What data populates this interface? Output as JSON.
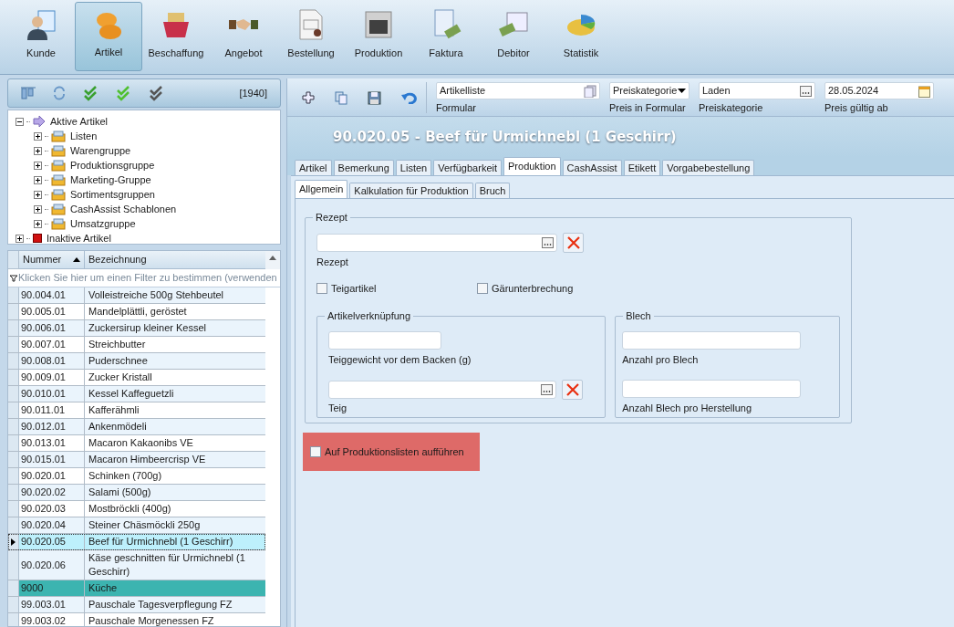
{
  "ribbon": [
    {
      "label": "Kunde",
      "selected": false
    },
    {
      "label": "Artikel",
      "selected": true
    },
    {
      "label": "Beschaffung",
      "selected": false
    },
    {
      "label": "Angebot",
      "selected": false
    },
    {
      "label": "Bestellung",
      "selected": false
    },
    {
      "label": "Produktion",
      "selected": false
    },
    {
      "label": "Faktura",
      "selected": false
    },
    {
      "label": "Debitor",
      "selected": false
    },
    {
      "label": "Statistik",
      "selected": false
    }
  ],
  "left_toolbar": {
    "count": "[1940]"
  },
  "tree": [
    {
      "label": "Aktive Artikel",
      "kind": "arrow",
      "expanded": true,
      "children": [
        {
          "label": "Listen",
          "kind": "folder",
          "expanded": false
        },
        {
          "label": "Warengruppe",
          "kind": "folder",
          "expanded": false
        },
        {
          "label": "Produktionsgruppe",
          "kind": "folder",
          "expanded": false
        },
        {
          "label": "Marketing-Gruppe",
          "kind": "folder",
          "expanded": false
        },
        {
          "label": "Sortimentsgruppen",
          "kind": "folder",
          "expanded": false
        },
        {
          "label": "CashAssist Schablonen",
          "kind": "folder",
          "expanded": false
        },
        {
          "label": "Umsatzgruppe",
          "kind": "folder",
          "expanded": false
        }
      ]
    },
    {
      "label": "Inaktive Artikel",
      "kind": "stop",
      "expanded": false
    }
  ],
  "grid": {
    "columns": [
      "Nummer",
      "Bezeichnung"
    ],
    "filter_hint": "Klicken Sie hier um einen Filter zu bestimmen (verwenden",
    "rows": [
      {
        "nummer": "90.004.01",
        "bezeichnung": "Volleistreiche 500g Stehbeutel",
        "selected": false,
        "highlighted": false
      },
      {
        "nummer": "90.005.01",
        "bezeichnung": "Mandelplättli, geröstet",
        "selected": false,
        "highlighted": false
      },
      {
        "nummer": "90.006.01",
        "bezeichnung": "Zuckersirup kleiner Kessel",
        "selected": false,
        "highlighted": false
      },
      {
        "nummer": "90.007.01",
        "bezeichnung": "Streichbutter",
        "selected": false,
        "highlighted": false
      },
      {
        "nummer": "90.008.01",
        "bezeichnung": "Puderschnee",
        "selected": false,
        "highlighted": false
      },
      {
        "nummer": "90.009.01",
        "bezeichnung": "Zucker Kristall",
        "selected": false,
        "highlighted": false
      },
      {
        "nummer": "90.010.01",
        "bezeichnung": "Kessel Kaffeguetzli",
        "selected": false,
        "highlighted": false
      },
      {
        "nummer": "90.011.01",
        "bezeichnung": "Kafferähmli",
        "selected": false,
        "highlighted": false
      },
      {
        "nummer": "90.012.01",
        "bezeichnung": "Ankenmödeli",
        "selected": false,
        "highlighted": false
      },
      {
        "nummer": "90.013.01",
        "bezeichnung": "Macaron Kakaonibs VE",
        "selected": false,
        "highlighted": false
      },
      {
        "nummer": "90.015.01",
        "bezeichnung": "Macaron Himbeercrisp VE",
        "selected": false,
        "highlighted": false
      },
      {
        "nummer": "90.020.01",
        "bezeichnung": "Schinken (700g)",
        "selected": false,
        "highlighted": false
      },
      {
        "nummer": "90.020.02",
        "bezeichnung": "Salami (500g)",
        "selected": false,
        "highlighted": false
      },
      {
        "nummer": "90.020.03",
        "bezeichnung": "Mostbröckli (400g)",
        "selected": false,
        "highlighted": false
      },
      {
        "nummer": "90.020.04",
        "bezeichnung": "Steiner Chäsmöckli 250g",
        "selected": false,
        "highlighted": false
      },
      {
        "nummer": "90.020.05",
        "bezeichnung": "Beef für Urmichnebl (1 Geschirr)",
        "selected": true,
        "highlighted": false
      },
      {
        "nummer": "90.020.06",
        "bezeichnung": "Käse geschnitten für Urmichnebl (1 Geschirr)",
        "selected": false,
        "highlighted": false
      },
      {
        "nummer": "9000",
        "bezeichnung": "Küche",
        "selected": false,
        "highlighted": true
      },
      {
        "nummer": "99.003.01",
        "bezeichnung": "Pauschale Tagesverpflegung FZ",
        "selected": false,
        "highlighted": false
      },
      {
        "nummer": "99.003.02",
        "bezeichnung": "Pauschale Morgenessen FZ",
        "selected": false,
        "highlighted": false
      }
    ]
  },
  "right_toolbar": {
    "fields": [
      {
        "kind": "lookup",
        "value": "Artikelliste",
        "label": "Formular"
      },
      {
        "kind": "dropdown",
        "value": "Preiskategorie",
        "label": "Preis in Formular"
      },
      {
        "kind": "ellipsis",
        "value": "Laden",
        "label": "Preiskategorie"
      },
      {
        "kind": "date",
        "value": "28.05.2024",
        "label": "Preis gültig ab"
      }
    ]
  },
  "title": "90.020.05 - Beef für Urmichnebl (1 Geschirr)",
  "tabs": [
    {
      "label": "Artikel",
      "selected": false
    },
    {
      "label": "Bemerkung",
      "selected": false
    },
    {
      "label": "Listen",
      "selected": false
    },
    {
      "label": "Verfügbarkeit",
      "selected": false
    },
    {
      "label": "Produktion",
      "selected": true
    },
    {
      "label": "CashAssist",
      "selected": false
    },
    {
      "label": "Etikett",
      "selected": false
    },
    {
      "label": "Vorgabebestellung",
      "selected": false
    }
  ],
  "subtabs": [
    {
      "label": "Allgemein",
      "selected": true
    },
    {
      "label": "Kalkulation für Produktion",
      "selected": false
    },
    {
      "label": "Bruch",
      "selected": false
    }
  ],
  "form": {
    "rezept_group": "Rezept",
    "rezept_label": "Rezept",
    "checkboxes": [
      {
        "label": "Teigartikel",
        "checked": false
      },
      {
        "label": "Gärunterbrechung",
        "checked": false
      }
    ],
    "artikel_group": "Artikelverknüpfung",
    "teiggewicht_label": "Teiggewicht vor dem Backen (g)",
    "teig_label": "Teig",
    "blech_group": "Blech",
    "anzahl_label": "Anzahl pro Blech",
    "anzahl_herstellung_label": "Anzahl Blech pro Herstellung",
    "production_list": {
      "label": "Auf Produktionslisten aufführen",
      "checked": false,
      "highlighted": true
    }
  }
}
